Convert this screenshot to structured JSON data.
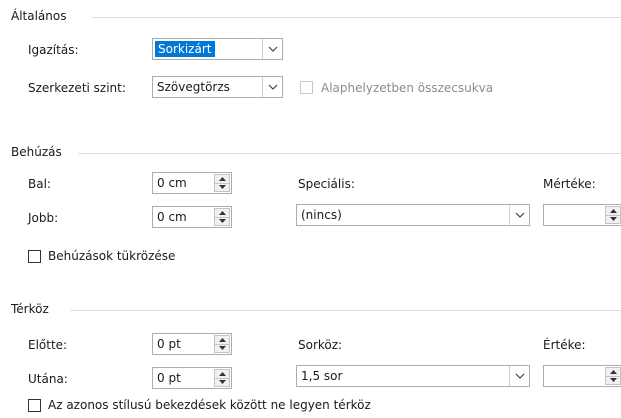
{
  "general": {
    "title": "Általános",
    "alignment": {
      "label": "Igazítás:",
      "value": "Sorkizárt"
    },
    "outline_level": {
      "label": "Szerkezeti szint:",
      "value": "Szövegtörzs"
    },
    "collapsed": {
      "label": "Alaphelyzetben összecsukva",
      "checked": false,
      "enabled": false
    }
  },
  "indent": {
    "title": "Behúzás",
    "left": {
      "label": "Bal:",
      "value": "0 cm"
    },
    "right": {
      "label": "Jobb:",
      "value": "0 cm"
    },
    "special": {
      "label": "Speciális:",
      "value": "(nincs)"
    },
    "by": {
      "label": "Mértéke:",
      "value": ""
    },
    "mirror": {
      "label": "Behúzások tükrözése",
      "checked": false
    }
  },
  "spacing": {
    "title": "Térköz",
    "before": {
      "label": "Előtte:",
      "value": "0 pt"
    },
    "after": {
      "label": "Utána:",
      "value": "0 pt"
    },
    "line_spacing": {
      "label": "Sorköz:",
      "value": "1,5 sor"
    },
    "at": {
      "label": "Értéke:",
      "value": ""
    },
    "no_space": {
      "label": "Az azonos stílusú bekezdések között ne legyen térköz",
      "checked": false
    }
  },
  "colors": {
    "accent": "#0078d7",
    "border": "#adadad",
    "separator": "#dcdcdc"
  }
}
